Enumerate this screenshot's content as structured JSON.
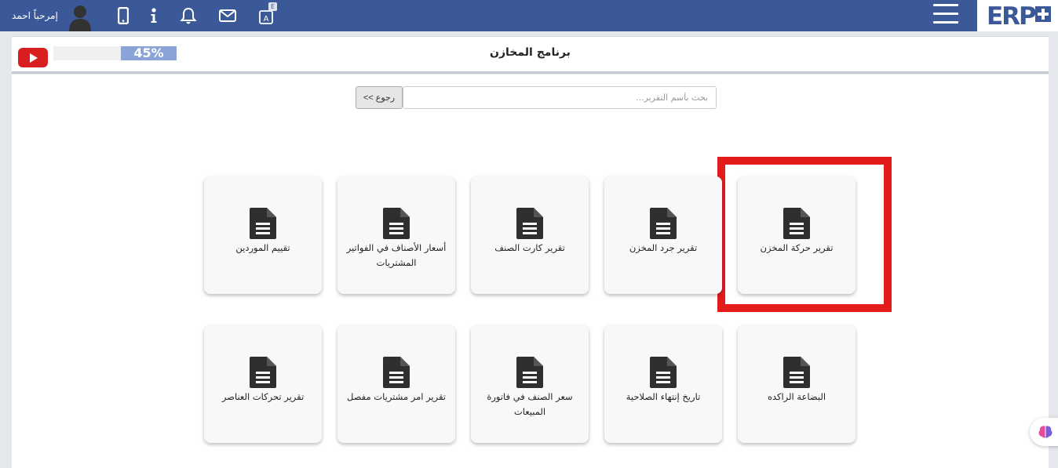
{
  "topbar": {
    "greeting": "إمرحباً احمد",
    "avatar_icon": "user-avatar-icon",
    "icons": [
      "mobile-icon",
      "info-icon",
      "bell-icon",
      "mail-icon",
      "translate-icon"
    ],
    "translate_badge": "E",
    "logo_text": "ERP",
    "color": "#3b5998"
  },
  "header": {
    "title": "برنامج المخازن",
    "progress_percent": 45,
    "progress_label": "45%",
    "video_icon": "youtube-icon"
  },
  "search": {
    "placeholder": "بحث بأسم التقرير...",
    "back_label": "<< رجوع"
  },
  "reports": [
    {
      "label": "تقرير حركة المخزن",
      "highlighted": true
    },
    {
      "label": "تقرير جرد المخزن"
    },
    {
      "label": "تقرير كارت الصنف"
    },
    {
      "label": "أسعار الأصناف في الفواتير المشتريات"
    },
    {
      "label": "تقييم الموردين"
    },
    {
      "label": "البضاعة الراكده"
    },
    {
      "label": "تاريخ إنتهاء الصلاحية"
    },
    {
      "label": "سعر الصنف في فاتورة المبيعات"
    },
    {
      "label": "تقرير امر مشتريات مفصل"
    },
    {
      "label": "تقرير تحركات العناصر"
    }
  ],
  "highlight_color": "#e41b1b"
}
